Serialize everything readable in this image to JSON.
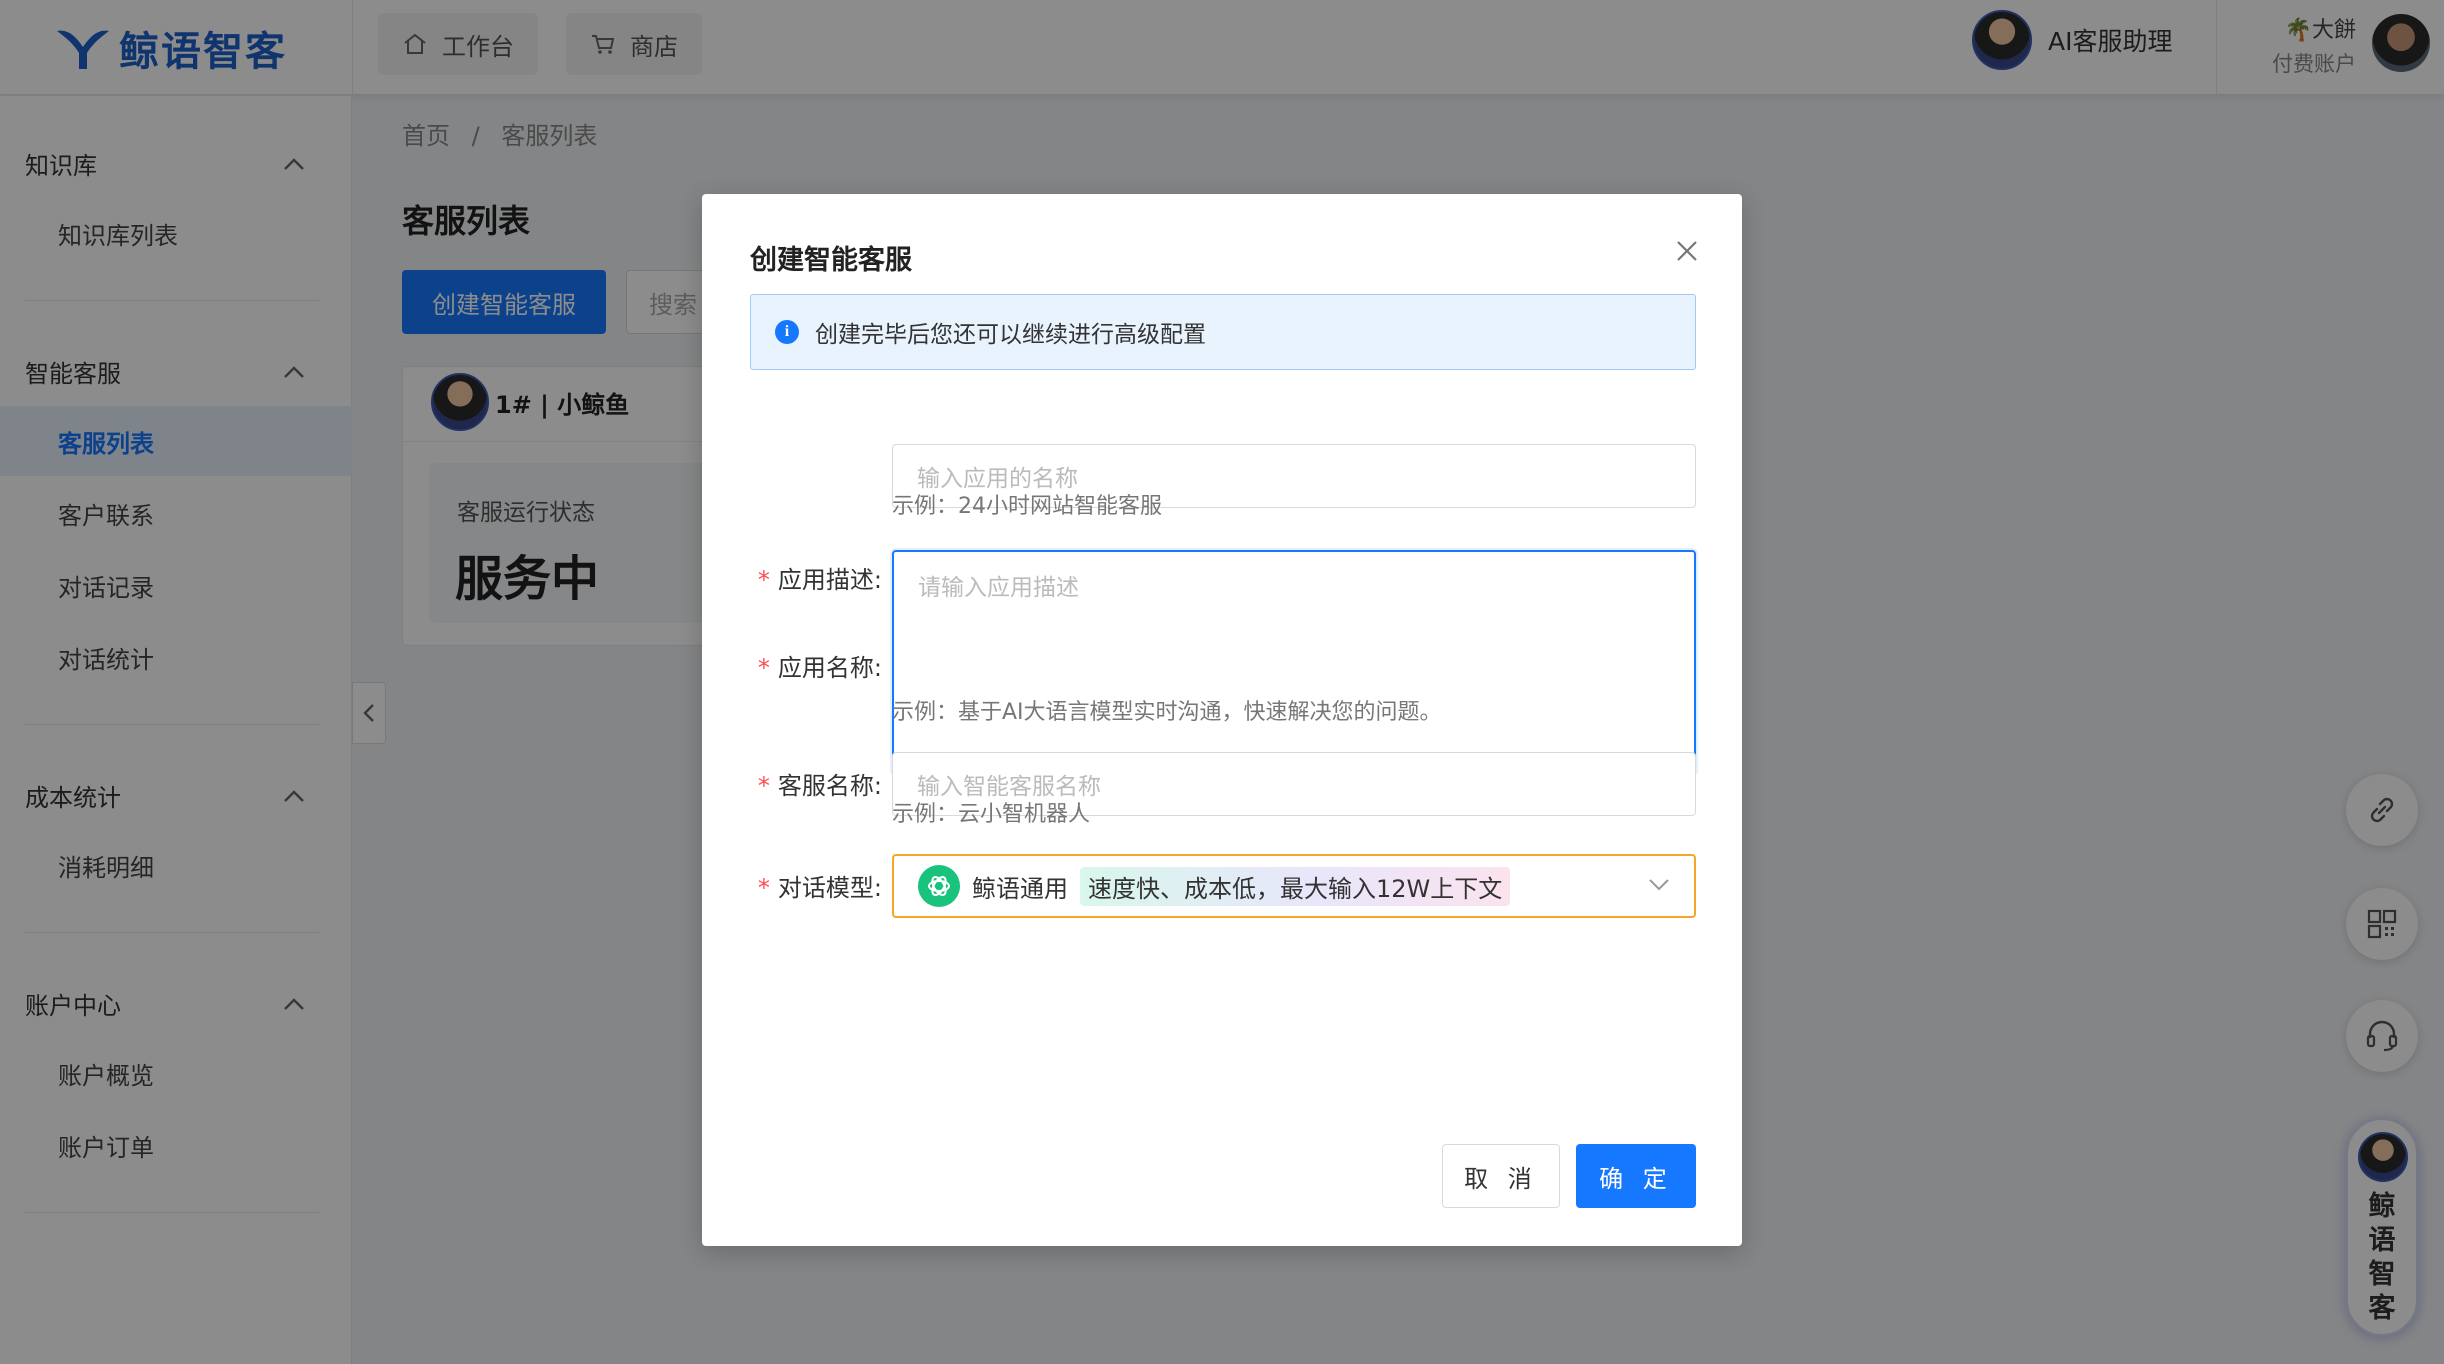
{
  "brand": {
    "logo_text": "鲸语智客"
  },
  "header": {
    "nav": [
      {
        "label": "工作台",
        "icon": "home-icon"
      },
      {
        "label": "商店",
        "icon": "cart-icon"
      }
    ],
    "assistant_label": "AI客服助理",
    "account_name": "🌴大餅",
    "account_type": "付费账户"
  },
  "sidebar": {
    "groups": [
      {
        "title": "知识库",
        "items": [
          "知识库列表"
        ]
      },
      {
        "title": "智能客服",
        "items": [
          "客服列表",
          "客户联系",
          "对话记录",
          "对话统计"
        ]
      },
      {
        "title": "成本统计",
        "items": [
          "消耗明细"
        ]
      },
      {
        "title": "账户中心",
        "items": [
          "账户概览",
          "账户订单"
        ]
      }
    ],
    "active_item": "客服列表"
  },
  "main": {
    "breadcrumb": [
      "首页",
      "/",
      "客服列表"
    ],
    "title": "客服列表",
    "create_button": "创建智能客服",
    "search_placeholder": "搜索",
    "card": {
      "name": "1# | 小鲸鱼",
      "status_label": "客服运行状态",
      "status_value": "服务中"
    }
  },
  "float": {
    "brand_text": "鲸语智客"
  },
  "modal": {
    "title": "创建智能客服",
    "alert": "创建完毕后您还可以继续进行高级配置",
    "fields": {
      "app_name": {
        "label": "应用名称:",
        "placeholder": "输入应用的名称",
        "hint": "示例：24小时网站智能客服"
      },
      "app_desc": {
        "label": "应用描述:",
        "placeholder": "请输入应用描述",
        "hint": "示例：基于AI大语言模型实时沟通，快速解决您的问题。"
      },
      "agent_name": {
        "label": "客服名称:",
        "placeholder": "输入智能客服名称",
        "hint": "示例：云小智机器人"
      },
      "model": {
        "label": "对话模型:",
        "value": "鲸语通用",
        "tag": "速度快、成本低，最大输入12W上下文"
      }
    },
    "cancel": "取 消",
    "confirm": "确 定"
  },
  "colors": {
    "primary": "#1677ff",
    "required": "#ff4d4f",
    "select_border": "#f5a623"
  }
}
